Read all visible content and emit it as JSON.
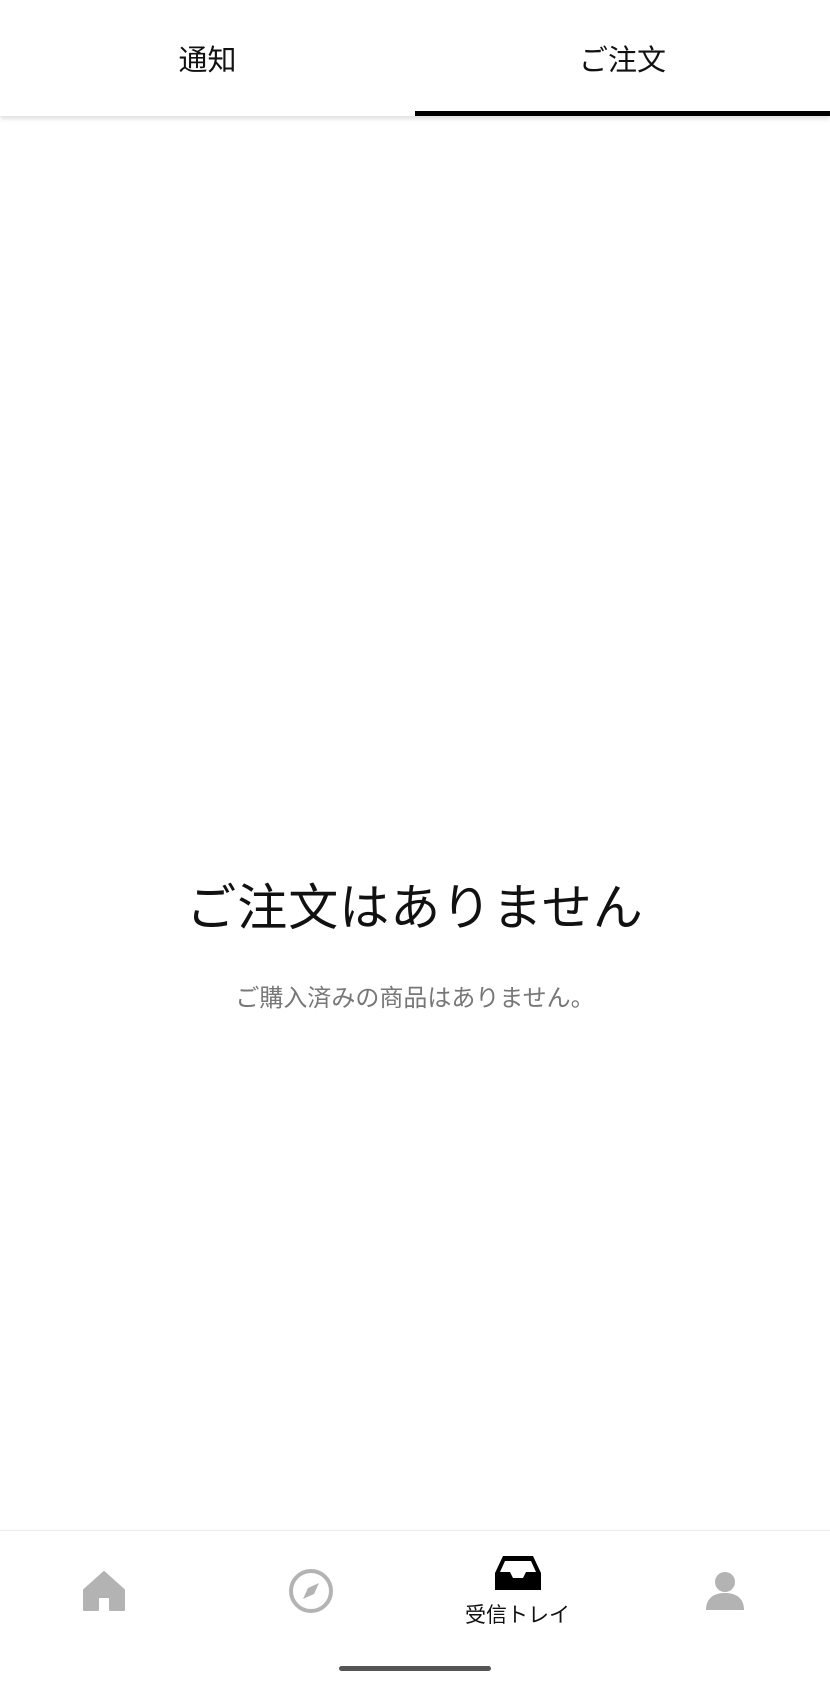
{
  "tabs": [
    {
      "label": "通知",
      "active": false
    },
    {
      "label": "ご注文",
      "active": true
    }
  ],
  "empty_state": {
    "title": "ご注文はありません",
    "subtitle": "ご購入済みの商品はありません。"
  },
  "bottom_nav": {
    "items": [
      {
        "icon": "home-icon",
        "label": ""
      },
      {
        "icon": "compass-icon",
        "label": ""
      },
      {
        "icon": "inbox-icon",
        "label": "受信トレイ"
      },
      {
        "icon": "profile-icon",
        "label": ""
      }
    ]
  },
  "colors": {
    "active": "#000000",
    "inactive_icon": "#b3b3b3",
    "secondary_text": "#777777"
  }
}
